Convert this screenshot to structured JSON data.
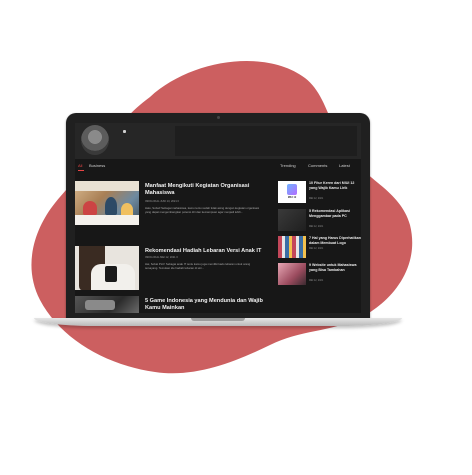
{
  "nav": {
    "home": "All",
    "business": "Business",
    "trending": "Trending",
    "comments": "Comments",
    "latest": "Latest"
  },
  "articles": [
    {
      "title": "Manfaat Mengikuti Kegiatan Organisasi Mahasiswa",
      "meta": "INFOLOKAL   JUNI 13, 2021   0",
      "excerpt": "Halo, Sobat! Sebagai mahasiswa, kamu tentu sudah tidak asing dengan kegiatan organisasi yang dapat mengembangkan potensi diri dan kemampuan agar menjadi lebih..."
    },
    {
      "title": "Rekomendasi Hadiah Lebaran Versi Anak IT",
      "meta": "INFOLOKAL   MEI 12, 2021   0",
      "excerpt": "Hai, Sobat PLC! Sebagai anak IT tentu kamu juga memiliki kado lebaran untuk orang tersayang. Temukan ide hadiah lebaran di sini..."
    },
    {
      "title": "5 Game Indonesia yang Mendunia dan Wajib Kamu Mainkan",
      "meta": "",
      "excerpt": ""
    }
  ],
  "sidebar": [
    {
      "title": "10 Fitur Keren dari MIUI 12 yang Wajib Kamu Lirik",
      "date": "MEI 12, 2021",
      "badge": "MIUI 12"
    },
    {
      "title": "5 Rekomendasi Aplikasi Menggambar pada PC",
      "date": "MEI 12, 2021"
    },
    {
      "title": "7 Hal yang Harus Diperhatikan dalam Membuat Logo",
      "date": "MEI 12, 2021"
    },
    {
      "title": "9 Website untuk Mahasiswa yang Bisa Tambahan",
      "date": "MEI 12, 2021"
    }
  ],
  "colors": {
    "blob": "#cc5f60",
    "accent": "#e84545",
    "screen_bg": "#171717"
  }
}
